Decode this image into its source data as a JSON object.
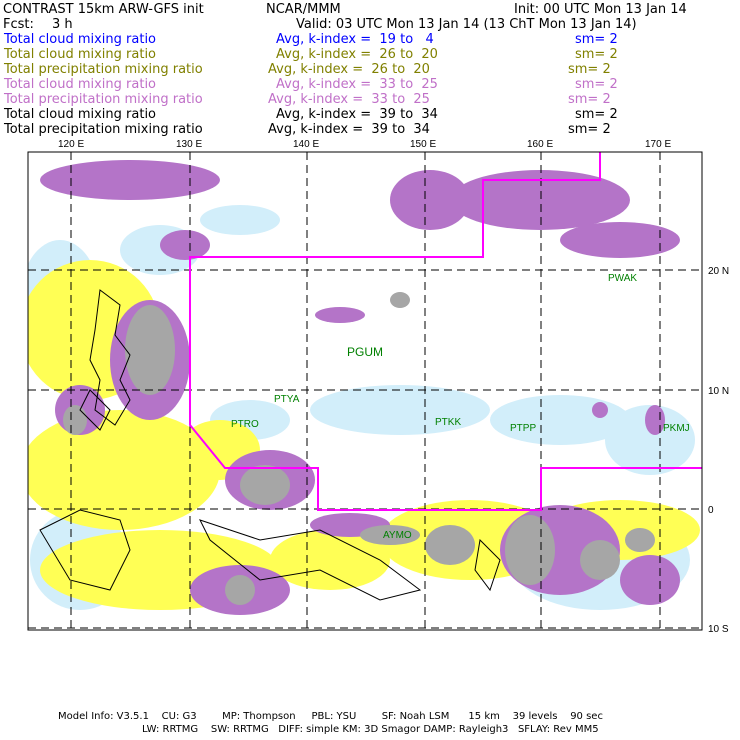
{
  "header": {
    "title": "CONTRAST 15km ARW-GFS init",
    "org": "NCAR/MMM",
    "init": "Init: 00 UTC Mon 13 Jan 14",
    "fcst_label": "Fcst:",
    "fcst_value": "3 h",
    "valid": "Valid: 03 UTC Mon 13 Jan 14 (13 ChT Mon 13 Jan 14)"
  },
  "fields": [
    {
      "name": "Total cloud mixing ratio",
      "avg": "Avg, k-index =  19 to   4",
      "sm": "sm= 2",
      "color": "#0000ff"
    },
    {
      "name": "Total cloud mixing ratio",
      "avg": "Avg, k-index =  26 to  20",
      "sm": "sm= 2",
      "color": "#808000"
    },
    {
      "name": "Total precipitation mixing ratio",
      "avg": "Avg, k-index =  26 to  20",
      "sm": "sm= 2",
      "color": "#808000"
    },
    {
      "name": "Total cloud mixing ratio",
      "avg": "Avg, k-index =  33 to  25",
      "sm": "sm= 2",
      "color": "#c070c8"
    },
    {
      "name": "Total precipitation mixing ratio",
      "avg": "Avg, k-index =  33 to  25",
      "sm": "sm= 2",
      "color": "#c070c8"
    },
    {
      "name": "Total cloud mixing ratio",
      "avg": "Avg, k-index =  39 to  34",
      "sm": "sm= 2",
      "color": "#000000"
    },
    {
      "name": "Total precipitation mixing ratio",
      "avg": "Avg, k-index =  39 to  34",
      "sm": "sm= 2",
      "color": "#000000"
    }
  ],
  "map": {
    "lon_labels": [
      "120 E",
      "130 E",
      "140 E",
      "150 E",
      "160 E",
      "170 E"
    ],
    "lat_labels": [
      "20 N",
      "10 N",
      "0",
      "10 S"
    ],
    "stations": [
      "PWAK",
      "PGUM",
      "PTYA",
      "PTRO",
      "PTKK",
      "PTPP",
      "PKMJ",
      "AYMO"
    ],
    "colors": {
      "yellow": "#ffff55",
      "light_blue": "#d2eefa",
      "purple": "#b474c8",
      "gray": "#a6a6a6",
      "boundary": "#ff00ff"
    }
  },
  "footer": {
    "line1": "Model Info: V3.5.1    CU: G3        MP: Thompson     PBL: YSU        SF: Noah LSM      15 km    39 levels    90 sec",
    "line2": "LW: RRTMG    SW: RRTMG   DIFF: simple KM: 3D Smagor DAMP: Rayleigh3   SFLAY: Rev MM5"
  }
}
